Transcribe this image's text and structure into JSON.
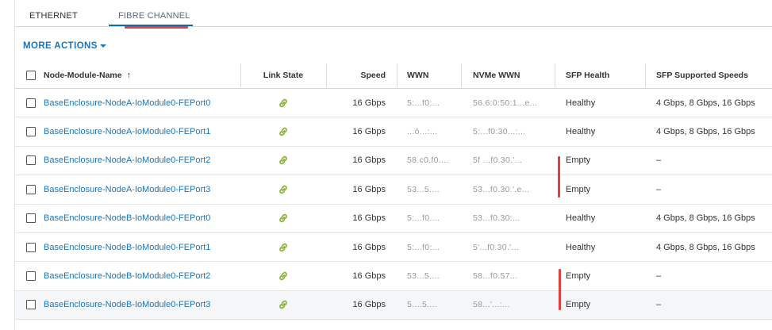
{
  "tabs": [
    {
      "label": "ETHERNET"
    },
    {
      "label": "FIBRE CHANNEL"
    }
  ],
  "more_actions": "MORE ACTIONS",
  "columns": {
    "name": "Node-Module-Name",
    "sort_indicator": "↑",
    "link_state": "Link State",
    "speed": "Speed",
    "wwn": "WWN",
    "nvme_wwn": "NVMe WWN",
    "sfp_health": "SFP Health",
    "sfp_speeds": "SFP Supported Speeds"
  },
  "rows": [
    {
      "name": "BaseEnclosure-NodeA-IoModule0-FEPort0",
      "link_state": "link-icon",
      "speed": "16 Gbps",
      "wwn": "5:...f0:...",
      "nvme_wwn": "56.6:0:50:1...e...",
      "sfp_health": "Healthy",
      "sfp_speeds": "4 Gbps, 8 Gbps, 16 Gbps"
    },
    {
      "name": "BaseEnclosure-NodeA-IoModule0-FEPort1",
      "link_state": "link-icon",
      "speed": "16 Gbps",
      "wwn": "...ö...:...",
      "nvme_wwn": "5:...f0:30...:...",
      "sfp_health": "Healthy",
      "sfp_speeds": "4 Gbps, 8 Gbps, 16 Gbps"
    },
    {
      "name": "BaseEnclosure-NodeA-IoModule0-FEPort2",
      "link_state": "link-icon",
      "speed": "16 Gbps",
      "wwn": "58.c0.f0....",
      "nvme_wwn": "5f ...f0.30.'...",
      "sfp_health": "Empty",
      "sfp_speeds": "–"
    },
    {
      "name": "BaseEnclosure-NodeA-IoModule0-FEPort3",
      "link_state": "link-icon",
      "speed": "16 Gbps",
      "wwn": "53...5....",
      "nvme_wwn": "53...f0.30.'.e...",
      "sfp_health": "Empty",
      "sfp_speeds": "–"
    },
    {
      "name": "BaseEnclosure-NodeB-IoModule0-FEPort0",
      "link_state": "link-icon",
      "speed": "16 Gbps",
      "wwn": "5:...f0....",
      "nvme_wwn": "53...f0.30:...",
      "sfp_health": "Healthy",
      "sfp_speeds": "4 Gbps, 8 Gbps, 16 Gbps"
    },
    {
      "name": "BaseEnclosure-NodeB-IoModule0-FEPort1",
      "link_state": "link-icon",
      "speed": "16 Gbps",
      "wwn": "5:...f0:...",
      "nvme_wwn": "5'...f0.30.'...",
      "sfp_health": "Healthy",
      "sfp_speeds": "4 Gbps, 8 Gbps, 16 Gbps"
    },
    {
      "name": "BaseEnclosure-NodeB-IoModule0-FEPort2",
      "link_state": "link-icon",
      "speed": "16 Gbps",
      "wwn": "53...5....",
      "nvme_wwn": "58...f0.57...",
      "sfp_health": "Empty",
      "sfp_speeds": "–"
    },
    {
      "name": "BaseEnclosure-NodeB-IoModule0-FEPort3",
      "link_state": "link-icon",
      "speed": "16 Gbps",
      "wwn": "5....5....",
      "nvme_wwn": "58...'...:...",
      "sfp_health": "Empty",
      "sfp_speeds": "–"
    }
  ],
  "colors": {
    "accent": "#1c75bc",
    "link_icon": "#8cb43c",
    "highlight": "#e0403e"
  }
}
